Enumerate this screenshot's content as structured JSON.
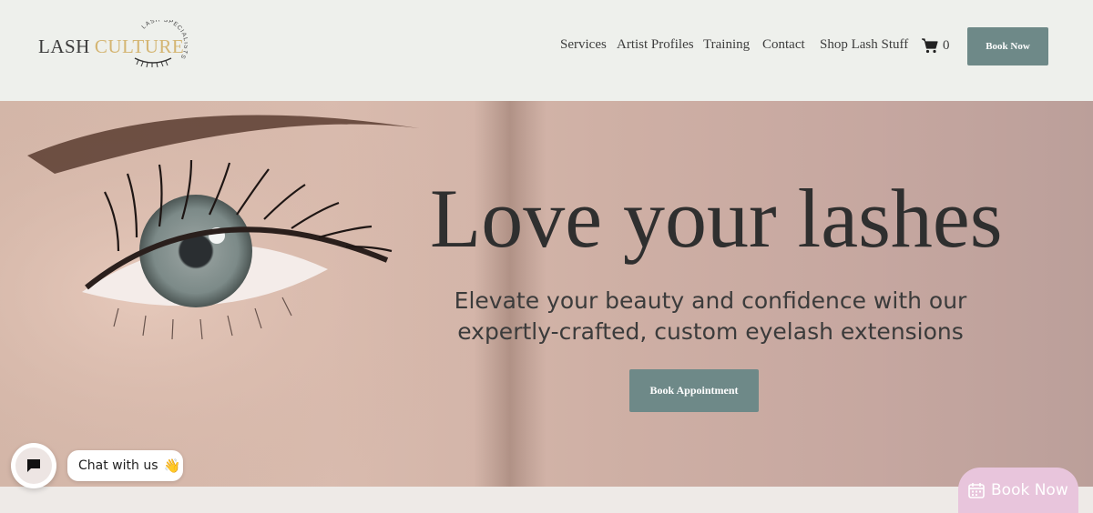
{
  "brand": {
    "word1": "LASH",
    "word2": "CULTURE",
    "tagline": "LASH SPECIALISTS"
  },
  "nav": {
    "items": [
      "Services",
      "Artist Profiles",
      "Training",
      "Contact",
      "Shop Lash Stuff"
    ],
    "cart_count": "0",
    "book_now": "Book Now"
  },
  "hero": {
    "title": "Love your lashes",
    "subtitle": "Elevate your beauty and confidence with our expertly-crafted, custom eyelash extensions",
    "button": "Book Appointment"
  },
  "chat": {
    "label": "Chat with us",
    "emoji": "👋"
  },
  "floating": {
    "book_now": "Book Now"
  },
  "colors": {
    "accent": "#6e8988",
    "logo_gold": "#d4b572",
    "header_bg": "#eef0ec",
    "float_button": "#e8c5dc"
  }
}
